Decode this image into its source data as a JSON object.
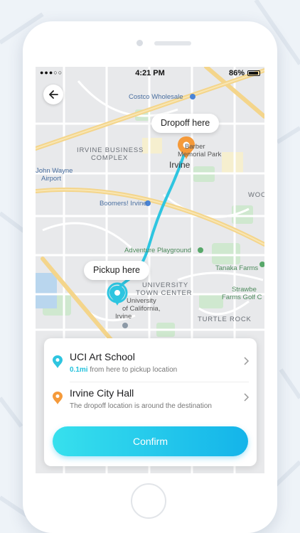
{
  "status_bar": {
    "carrier": "●●●○○",
    "time": "4:21 PM",
    "battery": "86%"
  },
  "map": {
    "labels": {
      "costco": "Costco Wholesale",
      "business_complex_1": "IRVINE BUSINESS",
      "business_complex_2": "COMPLEX",
      "memorial_park": "Memorial Park",
      "barber": "Barber",
      "irvine": "Irvine",
      "john_wayne_1": "John Wayne",
      "john_wayne_2": "Airport",
      "boomers": "Boomers! Irvine",
      "adventure": "Adventure Playground",
      "tanaka": "Tanaka Farms",
      "university_1": "UNIVERSITY",
      "university_2": "TOWN CENTER",
      "uci_1": "University",
      "uci_2": "of California,",
      "uci_3": "Irvine",
      "strawberry_1": "Strawbe",
      "strawberry_2": "Farms Golf C",
      "turtle_rock": "TURTLE ROCK",
      "woo": "WOO"
    },
    "dropoff_bubble": "Dropoff here",
    "pickup_bubble": "Pickup here",
    "colors": {
      "route": "#2ec5e0",
      "pickup": "#2ec5e0",
      "dropoff": "#f59a3a"
    }
  },
  "sheet": {
    "pickup": {
      "title": "UCI Art School",
      "distance": "0.1mi",
      "subtitle": "from here to pickup location"
    },
    "dropoff": {
      "title": "Irvine City Hall",
      "subtitle": "The dropoff location is around the destination"
    },
    "confirm_label": "Confirm"
  }
}
